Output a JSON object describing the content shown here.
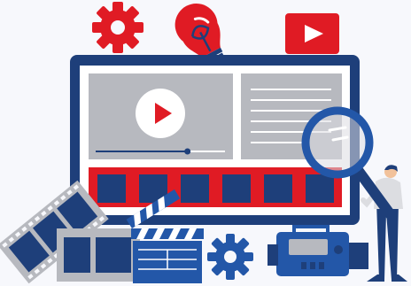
{
  "colors": {
    "background": "#f7f8fc",
    "navy": "#1e3f7a",
    "blue": "#2357a8",
    "red": "#e01b24",
    "gray": "#b7b9bf",
    "light_gray": "#dcdde1",
    "white": "#ffffff",
    "skin": "#f2c29b"
  },
  "icons": [
    "gear-icon",
    "lightbulb-icon",
    "youtube-play-icon",
    "video-play-icon",
    "magnifier-icon",
    "film-strip-icon",
    "clapperboard-icon",
    "video-camera-icon",
    "person-icon"
  ],
  "video_progress": 0.71,
  "thumbnail_count": 6
}
